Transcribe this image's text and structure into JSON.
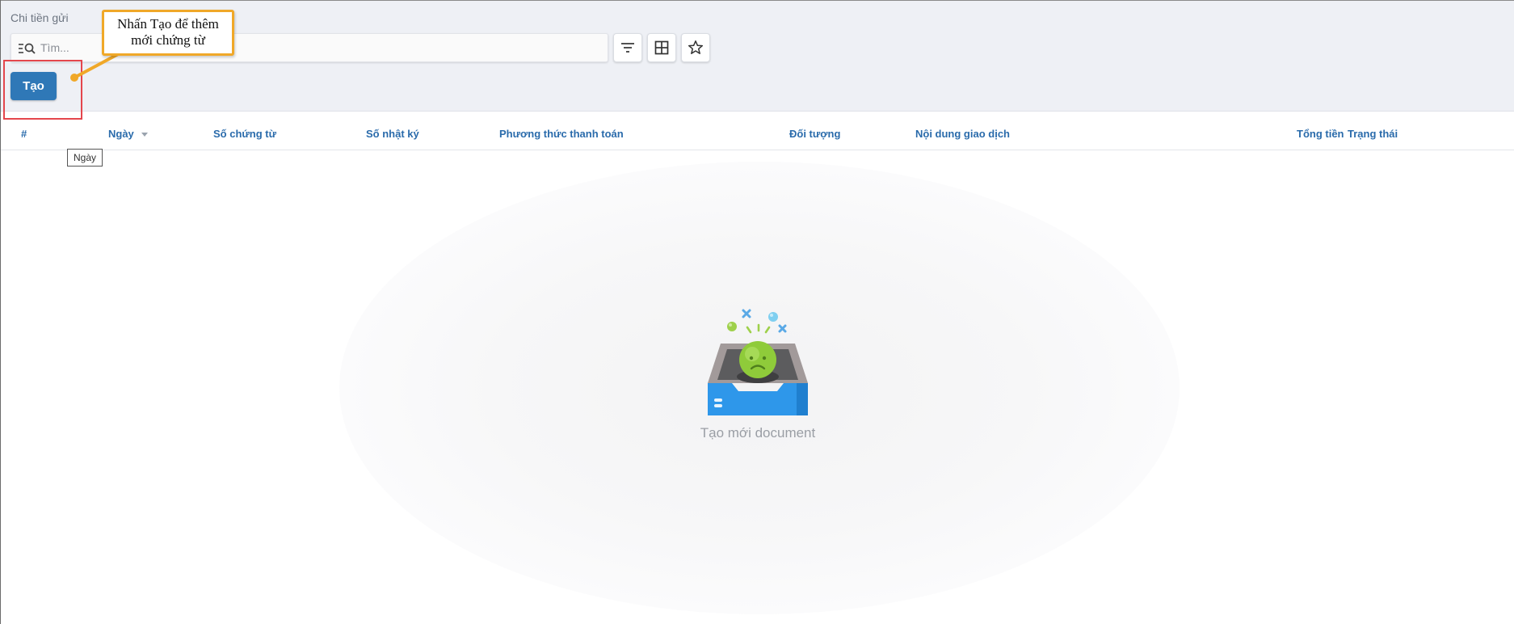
{
  "breadcrumb": "Chi tiền gửi",
  "search": {
    "placeholder": "Tìm..."
  },
  "toolbar": {
    "icons": [
      "filter-icon",
      "grid-view-icon",
      "star-icon"
    ],
    "create_label": "Tạo"
  },
  "callout": {
    "line1": "Nhấn Tạo để thêm",
    "line2": "mới chứng từ"
  },
  "table": {
    "columns": [
      "#",
      "Ngày",
      "Số chứng từ",
      "Số nhật ký",
      "Phương thức thanh toán",
      "Đối tượng",
      "Nội dung giao dịch",
      "Tổng tiền",
      "Trạng thái"
    ],
    "sorted_column_tooltip": "Ngày"
  },
  "empty_state": {
    "text": "Tạo mới document"
  },
  "colors": {
    "header_bg": "#eef0f5",
    "primary": "#2f78b7",
    "column_text": "#2a6bab",
    "highlight": "#e4464c",
    "callout_border": "#f0a828"
  }
}
